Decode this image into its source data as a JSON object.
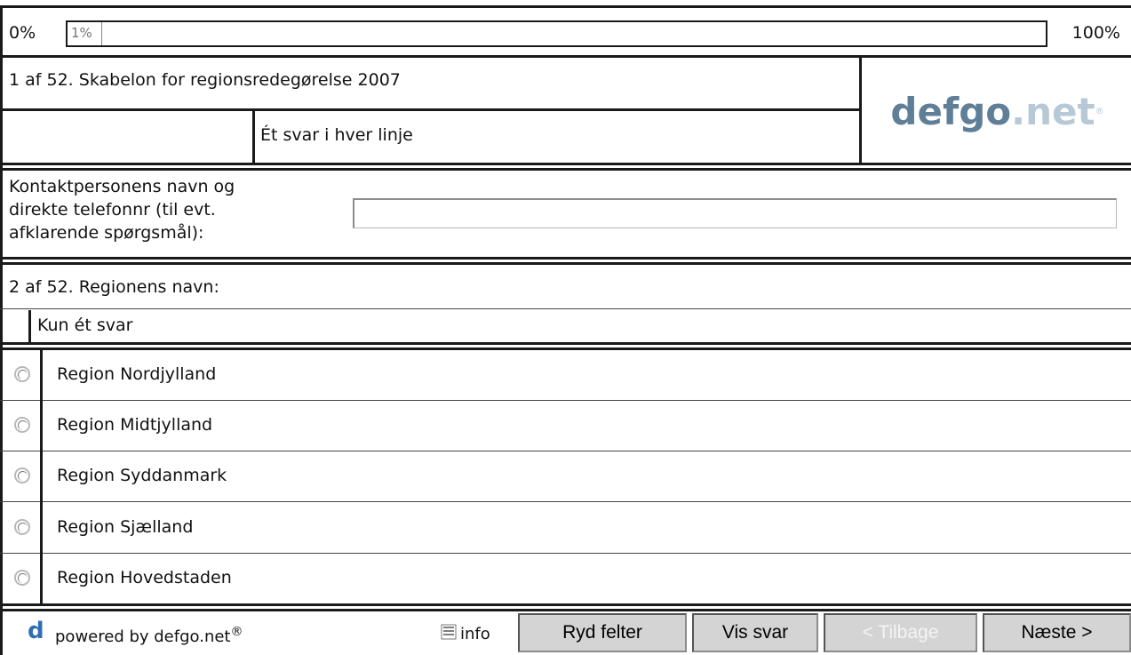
{
  "progress": {
    "left_label": "0%",
    "fill_label": "1%",
    "right_label": "100%",
    "value_percent": 1
  },
  "header": {
    "question_title": "1 af 52. Skabelon for regionsredegørelse 2007",
    "instruction": "Ét svar i hver linje",
    "logo_main": "defgo",
    "logo_suffix": ".net",
    "logo_mark": "®"
  },
  "contact": {
    "label_line1": "Kontaktpersonens navn og",
    "label_line2": "direkte telefonnr (til evt.",
    "label_line3": "afklarende spørgsmål):",
    "value": "",
    "placeholder": ""
  },
  "question2": {
    "title": "2 af 52. Regionens navn:",
    "instruction": "Kun ét svar",
    "options": [
      "Region Nordjylland",
      "Region Midtjylland",
      "Region Syddanmark",
      "Region Sjælland",
      "Region Hovedstaden"
    ]
  },
  "footer": {
    "logo_letter": "d",
    "powered_text": "powered by defgo.net",
    "registered_mark": "®",
    "info_label": "info",
    "info_icon": "info-icon",
    "buttons": {
      "clear": "Ryd felter",
      "show": "Vis svar",
      "back": "< Tilbage",
      "next": "Næste >"
    }
  },
  "colors": {
    "border": "#1a1a1a",
    "logo_primary": "#5f7f98",
    "logo_secondary": "#b7c8d6",
    "button_bg": "#d4d4d4",
    "disabled_text": "#f4f4f4"
  }
}
